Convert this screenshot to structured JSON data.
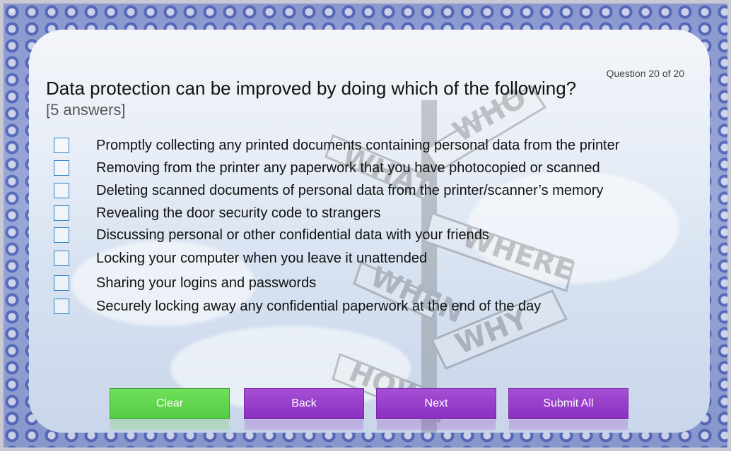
{
  "toolbar": {
    "collapse_glyph": "»"
  },
  "quiz": {
    "counter": "Question 20 of 20",
    "question": "Data protection can be improved by doing which of the following?",
    "answer_hint": "[5 answers]",
    "options": [
      {
        "label": "Promptly collecting any printed documents containing personal data from the printer",
        "checked": false
      },
      {
        "label": "Removing from the printer any paperwork that you have photocopied or scanned",
        "checked": false
      },
      {
        "label": "Deleting scanned documents of personal data from the printer/scanner’s memory",
        "checked": false
      },
      {
        "label": "Revealing the door security code to strangers",
        "checked": false
      },
      {
        "label": "Discussing personal or other confidential data with your friends",
        "checked": false
      },
      {
        "label": "Locking your computer when you leave it unattended",
        "checked": false
      },
      {
        "label": "Sharing your logins and passwords",
        "checked": false
      },
      {
        "label": "Securely locking away any confidential paperwork at the end of the day",
        "checked": false
      }
    ]
  },
  "buttons": {
    "clear": "Clear",
    "back": "Back",
    "next": "Next",
    "submit_all": "Submit All"
  },
  "background": {
    "signpost_words": [
      "WHO",
      "WHAT",
      "WHERE",
      "WHEN",
      "WHY",
      "HOW"
    ]
  },
  "colors": {
    "clear_button": "#5cd44a",
    "nav_button": "#9a3fcc",
    "checkbox_border": "#2f7fc0"
  }
}
